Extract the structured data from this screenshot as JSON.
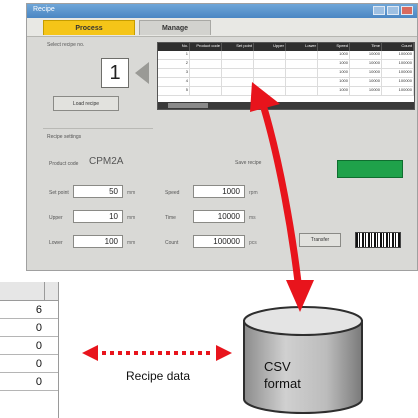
{
  "app_window": {
    "title": "Recipe",
    "tabs": [
      {
        "label": "Process",
        "active": true
      },
      {
        "label": "Manage",
        "active": false
      }
    ],
    "recipe_no_label": "Select recipe no.",
    "recipe_no_value": "1",
    "load_button": "Load recipe",
    "table": {
      "headers": [
        "No.",
        "Product code",
        "Set point",
        "Upper",
        "Lower",
        "Speed",
        "Time",
        "Count"
      ],
      "rows": [
        [
          "1",
          "",
          "",
          "",
          "",
          "1000",
          "10000",
          "100000"
        ],
        [
          "2",
          "",
          "",
          "",
          "",
          "1000",
          "10000",
          "100000"
        ],
        [
          "3",
          "",
          "",
          "",
          "",
          "1000",
          "10000",
          "100000"
        ],
        [
          "4",
          "",
          "",
          "",
          "",
          "1000",
          "10000",
          "100000"
        ],
        [
          "5",
          "",
          "",
          "",
          "",
          "1000",
          "10000",
          "100000"
        ]
      ]
    },
    "setting_group_label": "Recipe settings",
    "product_label": "Product code",
    "product_value": "CPM2A",
    "save_label": "Save recipe",
    "fields_left": [
      {
        "label": "Set point",
        "value": "50",
        "unit": "mm"
      },
      {
        "label": "Upper",
        "value": "10",
        "unit": "mm"
      },
      {
        "label": "Lower",
        "value": "100",
        "unit": "mm"
      }
    ],
    "fields_right": [
      {
        "label": "Speed",
        "value": "1000",
        "unit": "rpm"
      },
      {
        "label": "Time",
        "value": "10000",
        "unit": "ms"
      },
      {
        "label": "Count",
        "value": "100000",
        "unit": "pcs"
      }
    ],
    "transfer_button": "Transfer",
    "colors": {
      "active_tab": "#f5c518",
      "transfer_green": "#1fa24a",
      "arrow_red": "#e8141c"
    }
  },
  "spreadsheet": {
    "cells": [
      "6",
      "0",
      "0",
      "0",
      "0"
    ]
  },
  "csv_icon": {
    "line1": "CSV",
    "line2": "format"
  },
  "caption": "Recipe data"
}
